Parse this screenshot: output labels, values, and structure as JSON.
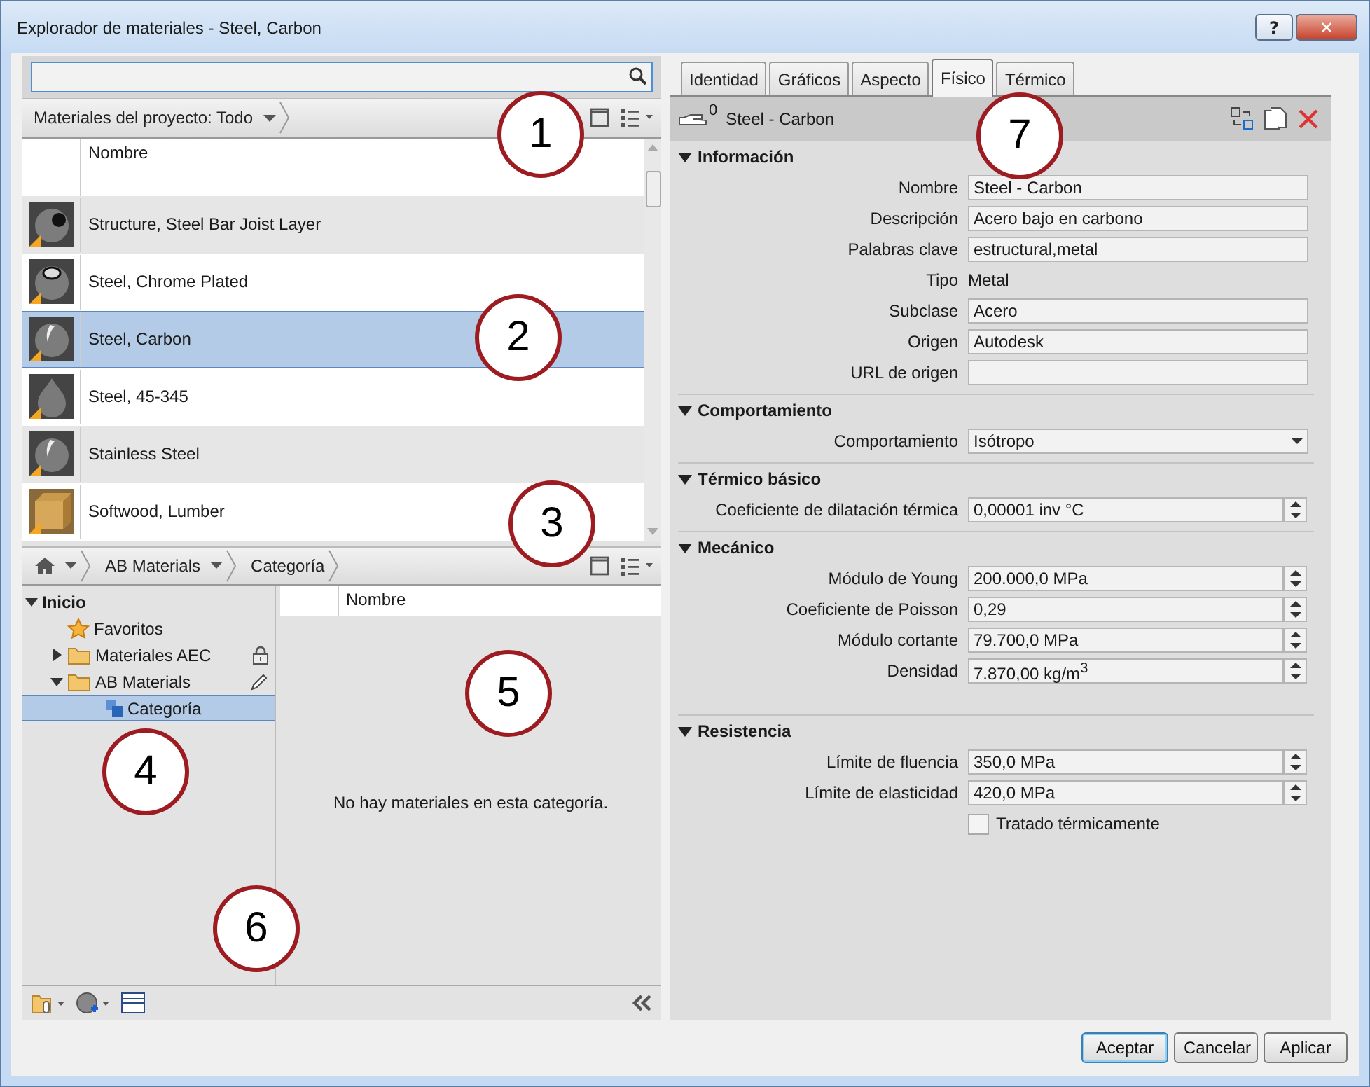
{
  "window": {
    "title": "Explorador de materiales - Steel, Carbon",
    "controls": [
      {
        "kind": "help",
        "label": "?"
      },
      {
        "kind": "close",
        "label": "✕"
      }
    ]
  },
  "project_bar": {
    "label": "Materiales del proyecto: Todo"
  },
  "materials": {
    "column": "Nombre",
    "rows": [
      {
        "name": "Structure, Steel Bar Joist Layer",
        "kind": "hollow",
        "selected": false
      },
      {
        "name": "Steel, Chrome Plated",
        "kind": "chrome",
        "selected": false
      },
      {
        "name": "Steel, Carbon",
        "kind": "sphere",
        "selected": true
      },
      {
        "name": "Steel, 45-345",
        "kind": "drop",
        "selected": false
      },
      {
        "name": "Stainless Steel",
        "kind": "sphere",
        "selected": false
      },
      {
        "name": "Softwood, Lumber",
        "kind": "cube",
        "selected": false
      }
    ]
  },
  "library_bar": {
    "crumbs": [
      "AB Materials",
      "Categoría"
    ]
  },
  "tree": [
    {
      "label": "Inicio",
      "kind": "root",
      "expanded": true,
      "selected": false,
      "children": [
        {
          "label": "Favoritos",
          "kind": "favorites",
          "selected": false
        },
        {
          "label": "Materiales AEC",
          "kind": "folder",
          "locked": true,
          "expanded": false,
          "selected": false
        },
        {
          "label": "AB Materials",
          "kind": "folder",
          "editable": true,
          "expanded": true,
          "selected": false,
          "children": [
            {
              "label": "Categoría",
              "kind": "category",
              "selected": true
            }
          ]
        }
      ]
    }
  ],
  "library_list": {
    "column": "Nombre",
    "empty_message": "No hay materiales en esta categoría."
  },
  "tabs": [
    {
      "label": "Identidad",
      "selected": false
    },
    {
      "label": "Gráficos",
      "selected": false
    },
    {
      "label": "Aspecto",
      "selected": false
    },
    {
      "label": "Físico",
      "selected": true
    },
    {
      "label": "Térmico",
      "selected": false
    }
  ],
  "asset": {
    "count": "0",
    "name": "Steel - Carbon"
  },
  "sections": [
    {
      "title": "Información",
      "expanded": true,
      "rows": [
        {
          "kind": "text",
          "label": "Nombre",
          "value": "Steel - Carbon"
        },
        {
          "kind": "text",
          "label": "Descripción",
          "value": "Acero bajo en carbono"
        },
        {
          "kind": "text",
          "label": "Palabras clave",
          "value": "estructural,metal"
        },
        {
          "kind": "static",
          "label": "Tipo",
          "value": "Metal"
        },
        {
          "kind": "text",
          "label": "Subclase",
          "value": "Acero"
        },
        {
          "kind": "text",
          "label": "Origen",
          "value": "Autodesk"
        },
        {
          "kind": "text",
          "label": "URL de origen"
        }
      ]
    },
    {
      "title": "Comportamiento",
      "expanded": true,
      "rows": [
        {
          "kind": "dropdown",
          "label": "Comportamiento",
          "value": "Isótropo"
        }
      ]
    },
    {
      "title": "Térmico básico",
      "expanded": true,
      "rows": [
        {
          "kind": "spinner",
          "label": "Coeficiente de dilatación térmica",
          "value": "0,00001 inv °C"
        }
      ]
    },
    {
      "title": "Mecánico",
      "expanded": true,
      "rows": [
        {
          "kind": "spinner",
          "label": "Módulo de Young",
          "value": "200.000,0 MPa"
        },
        {
          "kind": "spinner",
          "label": "Coeficiente de Poisson",
          "value": "0,29"
        },
        {
          "kind": "spinner",
          "label": "Módulo cortante",
          "value": "79.700,0 MPa"
        },
        {
          "kind": "spinner",
          "label": "Densidad",
          "value": "7.870,00 kg/m$^{3}$"
        }
      ]
    },
    {
      "title": "Resistencia",
      "expanded": true,
      "rows": [
        {
          "kind": "spinner",
          "label": "Límite de fluencia",
          "value": "350,0 MPa"
        },
        {
          "kind": "spinner",
          "label": "Límite de elasticidad",
          "value": "420,0 MPa"
        },
        {
          "kind": "checkbox",
          "label": "Tratado térmicamente",
          "checked": false
        }
      ]
    }
  ],
  "buttons": [
    {
      "label": "Aceptar",
      "default": true
    },
    {
      "label": "Cancelar",
      "default": false
    },
    {
      "label": "Aplicar",
      "default": false
    }
  ],
  "callouts": [
    "1",
    "2",
    "3",
    "4",
    "5",
    "6",
    "7"
  ]
}
